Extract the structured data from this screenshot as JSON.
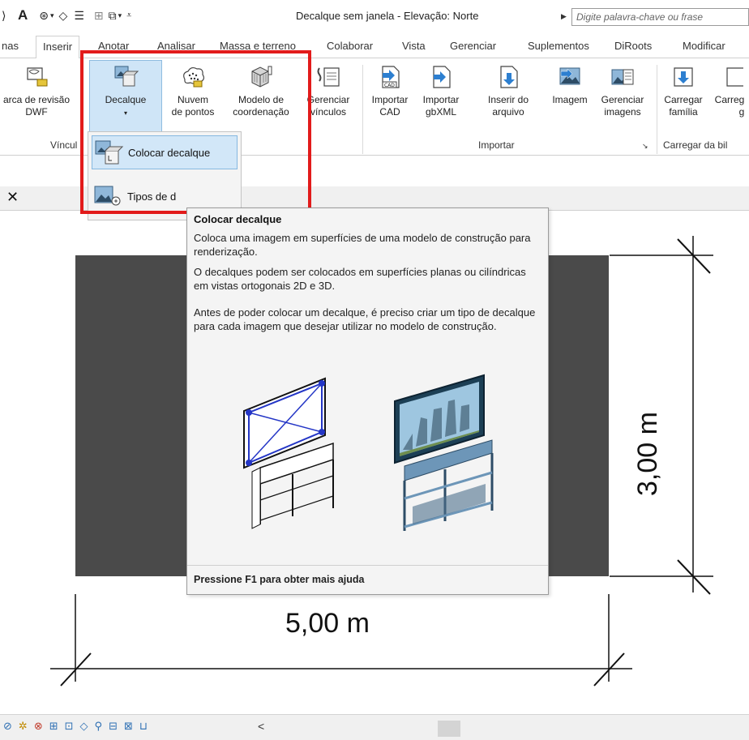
{
  "window": {
    "title": "Decalque sem janela - Elevação: Norte",
    "search_placeholder": "Digite palavra-chave ou frase"
  },
  "quick_access": {
    "text_icon_glyph": "A"
  },
  "tabs": [
    {
      "label": "nas"
    },
    {
      "label": "Inserir",
      "active": true
    },
    {
      "label": "Anotar"
    },
    {
      "label": "Analisar"
    },
    {
      "label": "Massa e terreno"
    },
    {
      "label": "Colaborar"
    },
    {
      "label": "Vista"
    },
    {
      "label": "Gerenciar"
    },
    {
      "label": "Suplementos"
    },
    {
      "label": "DiRoots"
    },
    {
      "label": "Modificar"
    }
  ],
  "ribbon": {
    "buttons": [
      {
        "label_line1": "arca de revisão",
        "label_line2": "DWF",
        "icon": "dwf-markup-icon"
      },
      {
        "label_line1": "Decalque",
        "label_line2": "▾",
        "icon": "decal-icon"
      },
      {
        "label_line1": "Nuvem",
        "label_line2": "de pontos",
        "icon": "point-cloud-icon"
      },
      {
        "label_line1": "Modelo de",
        "label_line2": "coordenação",
        "icon": "coordination-model-icon"
      },
      {
        "label_line1": "Gerenciar",
        "label_line2": "vínculos",
        "icon": "manage-links-icon"
      },
      {
        "label_line1": "Importar",
        "label_line2": "CAD",
        "icon": "import-cad-icon"
      },
      {
        "label_line1": "Importar",
        "label_line2": "gbXML",
        "icon": "import-gbxml-icon"
      },
      {
        "label_line1": "Inserir do",
        "label_line2": "arquivo",
        "icon": "insert-from-file-icon"
      },
      {
        "label_line1": "Imagem",
        "label_line2": "",
        "icon": "image-icon"
      },
      {
        "label_line1": "Gerenciar",
        "label_line2": "imagens",
        "icon": "manage-images-icon"
      },
      {
        "label_line1": "Carregar",
        "label_line2": "família",
        "icon": "load-family-icon"
      },
      {
        "label_line1": "Carreg",
        "label_line2": "g",
        "icon": "load-group-icon"
      }
    ],
    "panels": {
      "link": "Víncul",
      "import": "Importar",
      "library": "Carregar da bil"
    }
  },
  "dropdown": {
    "items": [
      {
        "label": "Colocar decalque",
        "highlighted": true
      },
      {
        "label": "Tipos de d"
      }
    ]
  },
  "tooltip": {
    "title": "Colocar decalque",
    "p1": "Coloca uma imagem em superfícies de uma modelo de construção para renderização.",
    "p2": "O decalques podem ser colocados em superfícies planas ou cilíndricas em vistas ortogonais 2D e 3D.",
    "p3": "Antes de poder colocar um decalque, é preciso criar um tipo de decalque para cada imagem que desejar utilizar no modelo de construção.",
    "footer": "Pressione F1 para obter mais ajuda"
  },
  "drawing": {
    "dim_horizontal": "5,00 m",
    "dim_vertical": "3,00 m"
  },
  "status": {
    "arrow": "<"
  },
  "colors": {
    "highlight_box": "#e21b1b",
    "wall": "#4a4a4a",
    "hover": "#cfe5f7"
  }
}
